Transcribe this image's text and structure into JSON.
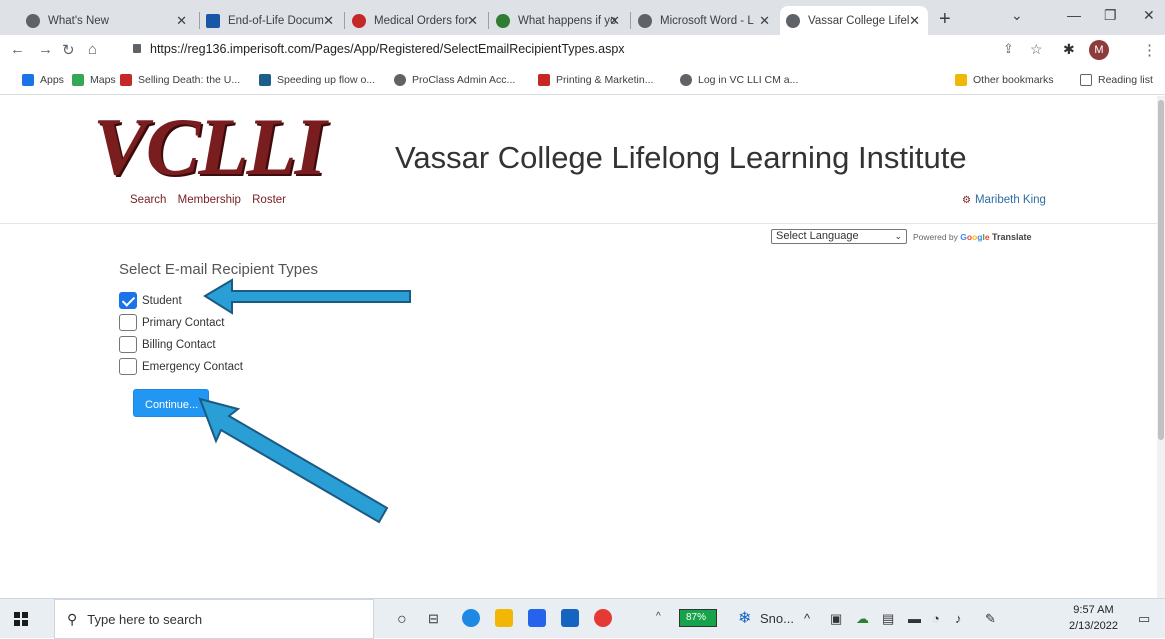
{
  "browser": {
    "tabs": [
      {
        "label": "What's New",
        "icon": "globe-icon",
        "color": "#5f6368"
      },
      {
        "label": "End-of-Life Docum",
        "icon": "wm-icon",
        "color": "#1a56a8"
      },
      {
        "label": "Medical Orders for",
        "icon": "apple-icon",
        "color": "#c62828"
      },
      {
        "label": "What happens if yo",
        "icon": "figure-icon",
        "color": "#2e7d32"
      },
      {
        "label": "Microsoft Word - L",
        "icon": "globe-icon",
        "color": "#5f6368"
      },
      {
        "label": "Vassar College Lifel",
        "icon": "globe-icon",
        "color": "#5f6368",
        "active": true
      }
    ],
    "url": "https://reg136.imperisoft.com/Pages/App/Registered/SelectEmailRecipientTypes.aspx",
    "profile_initial": "M",
    "bookmarks": [
      {
        "label": "Apps",
        "icon": "apps-grid-icon",
        "color": "#1a73e8"
      },
      {
        "label": "Maps",
        "icon": "maps-icon",
        "color": "#34a853"
      },
      {
        "label": "Selling Death: the U...",
        "icon": "cp-icon",
        "color": "#c62828"
      },
      {
        "label": "Speeding up flow o...",
        "icon": "tile-icon",
        "color": "#1b5e88"
      },
      {
        "label": "ProClass Admin Acc...",
        "icon": "globe-icon",
        "color": "#5f6368"
      },
      {
        "label": "Printing & Marketin...",
        "icon": "printer-icon",
        "color": "#c62828"
      },
      {
        "label": "Log in VC LLI CM a...",
        "icon": "globe-icon",
        "color": "#5f6368"
      }
    ],
    "other_bookmarks": "Other bookmarks",
    "reading_list": "Reading list"
  },
  "site": {
    "logo_text": "VCLLI",
    "institute_name": "Vassar College Lifelong Learning Institute",
    "nav": [
      "Search",
      "Membership",
      "Roster"
    ],
    "user_name": "Maribeth King",
    "language_select": "Select Language",
    "powered_by": "Powered by",
    "google": "Google",
    "translate": "Translate"
  },
  "form": {
    "heading": "Select E-mail Recipient Types",
    "options": [
      {
        "label": "Student",
        "checked": true
      },
      {
        "label": "Primary Contact",
        "checked": false
      },
      {
        "label": "Billing Contact",
        "checked": false
      },
      {
        "label": "Emergency Contact",
        "checked": false
      }
    ],
    "continue_label": "Continue..."
  },
  "annotation": {
    "arrow_color": "#2a9fd6"
  },
  "taskbar": {
    "search_placeholder": "Type here to search",
    "battery": "87%",
    "snow_label": "Sno...",
    "time": "9:57 AM",
    "date": "2/13/2022"
  }
}
